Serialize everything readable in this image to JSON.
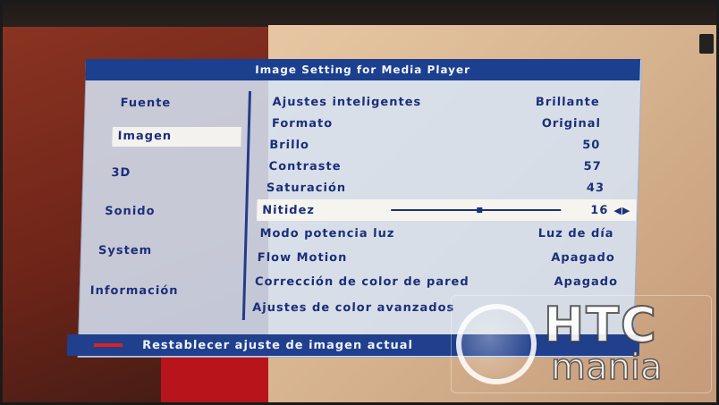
{
  "menu": {
    "title": "Image Setting for Media Player",
    "sidebar": [
      {
        "label": "Fuente"
      },
      {
        "label": "Imagen",
        "selected": true
      },
      {
        "label": "3D"
      },
      {
        "label": "Sonido"
      },
      {
        "label": "System"
      },
      {
        "label": "Información"
      }
    ],
    "settings": [
      {
        "label": "Ajustes inteligentes",
        "value": "Brillante"
      },
      {
        "label": "Formato",
        "value": "Original"
      },
      {
        "label": "Brillo",
        "value": "50"
      },
      {
        "label": "Contraste",
        "value": "57"
      },
      {
        "label": "Saturación",
        "value": "43"
      },
      {
        "label": "Nitidez",
        "value": "16",
        "slider_fraction": 0.52
      },
      {
        "label": "Modo potencia luz",
        "value": "Luz de día"
      },
      {
        "label": "Flow Motion",
        "value": "Apagado"
      },
      {
        "label": "Corrección de color de pared",
        "value": "Apagado"
      },
      {
        "label": "Ajustes de color avanzados",
        "value": ""
      }
    ],
    "arrows_glyph": "◀▶",
    "footer": {
      "text": "Restablecer ajuste de imagen actual",
      "key_color": "#e02020"
    }
  },
  "watermark": {
    "line1": "HTC",
    "line2": "mania"
  },
  "colors": {
    "title_bar": "#1c3f8e",
    "menu_text": "#1b2f7a",
    "panel": "#d6e4f6"
  }
}
